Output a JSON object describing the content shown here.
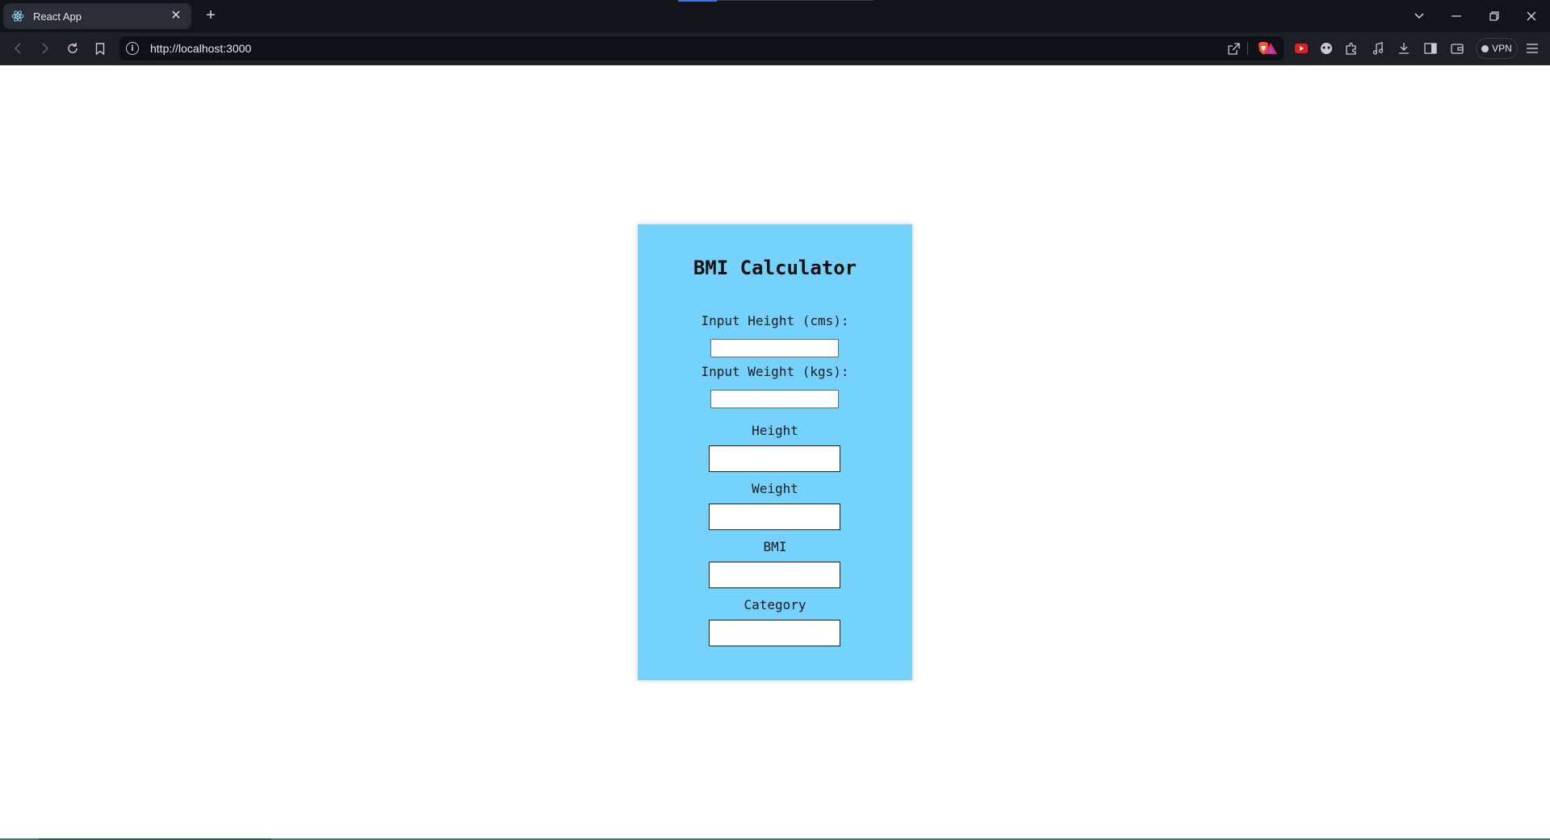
{
  "browser": {
    "tab_title": "React App",
    "url": "http://localhost:3000",
    "vpn_label": "VPN"
  },
  "app": {
    "title": "BMI Calculator",
    "height_input_label": "Input Height (cms):",
    "weight_input_label": "Input Weight (kgs):",
    "height_output_label": "Height",
    "weight_output_label": "Weight",
    "bmi_output_label": "BMI",
    "category_output_label": "Category",
    "height_input_value": "",
    "weight_input_value": ""
  },
  "colors": {
    "card_background": "#74d2fd",
    "browser_chrome": "#12141a"
  }
}
